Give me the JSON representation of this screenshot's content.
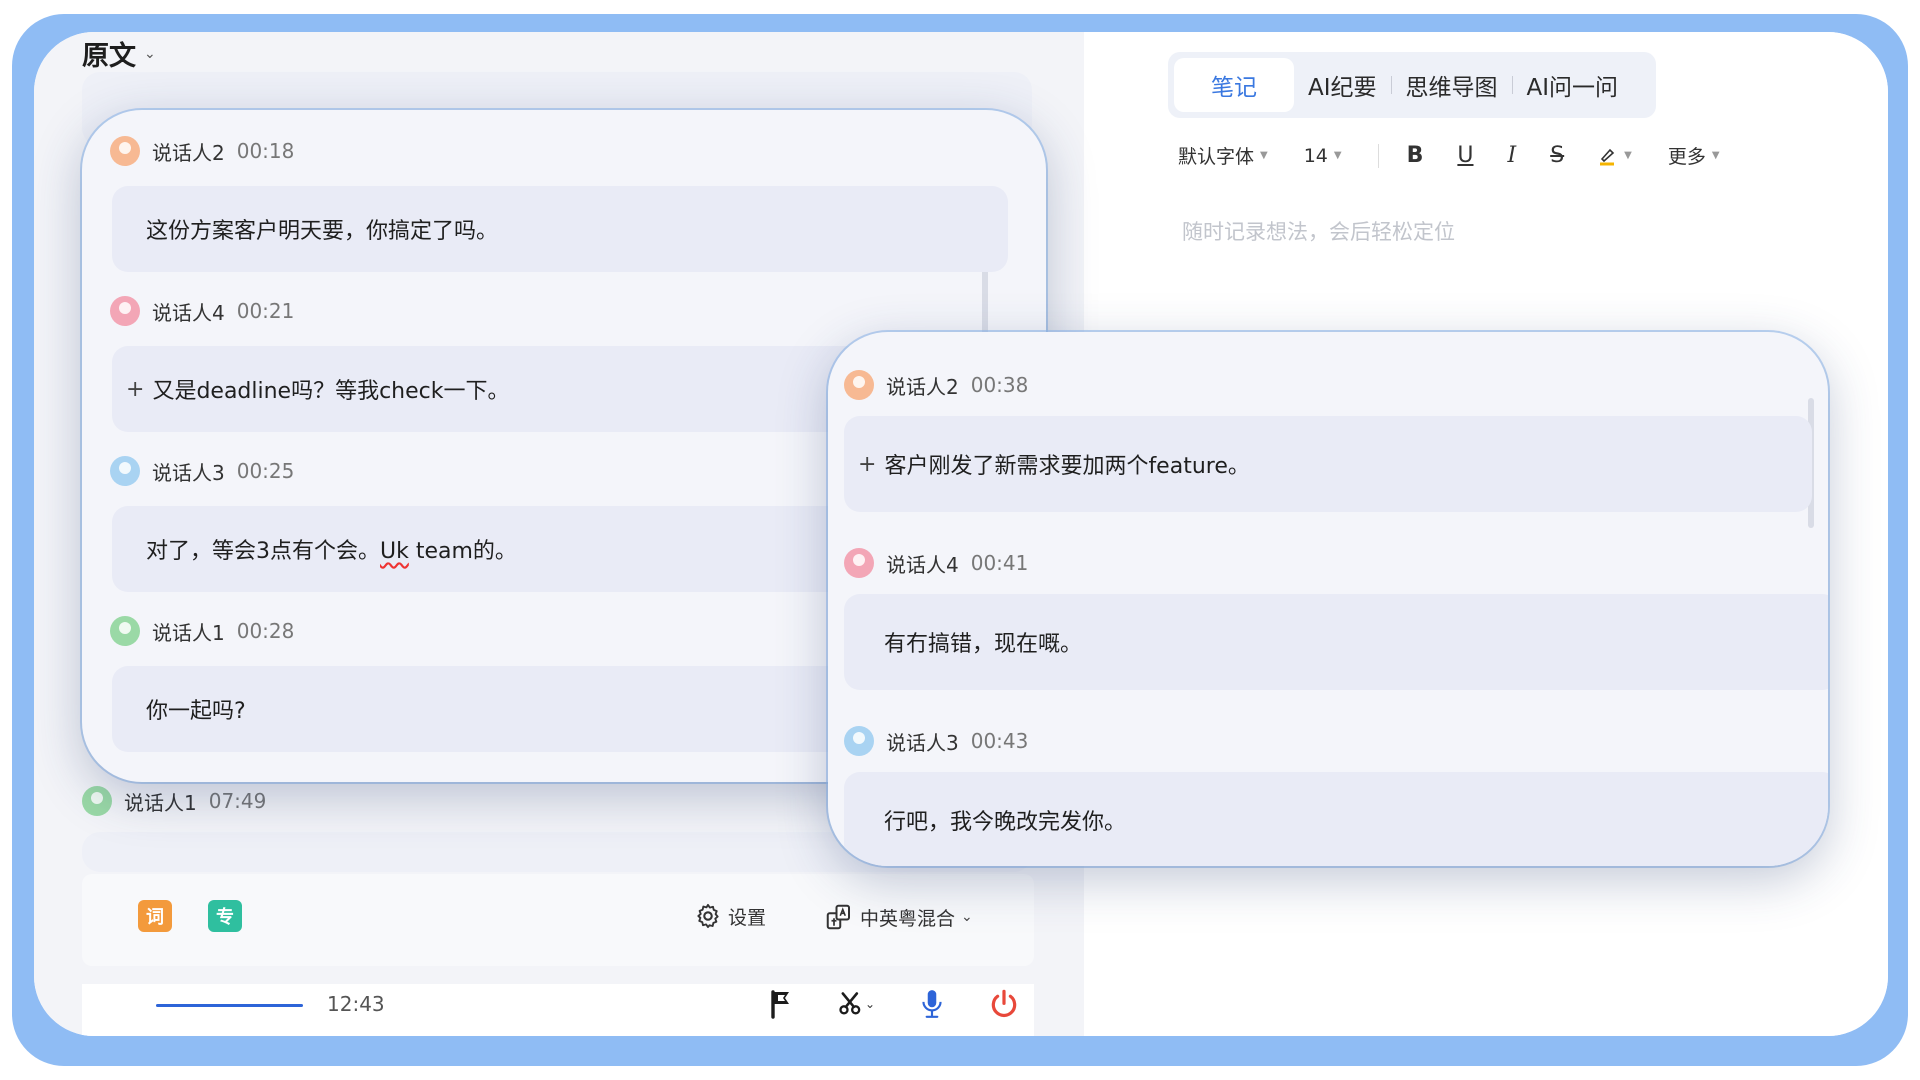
{
  "left": {
    "header_title": "原文",
    "tail_speaker": "说话人1",
    "tail_time": "07:49",
    "controls": {
      "badge_ci": "词",
      "badge_zhuan": "专",
      "settings_label": "设置",
      "language_label": "中英粤混合"
    },
    "player": {
      "progress": 0.15,
      "total_time": "12:43"
    }
  },
  "right": {
    "tabs": [
      "笔记",
      "AI纪要",
      "思维导图",
      "AI问一问"
    ],
    "toolbar": {
      "font": "默认字体",
      "size": "14",
      "more": "更多"
    },
    "note_placeholder": "随时记录想法，会后轻松定位"
  },
  "bubble_a": [
    {
      "speaker": "说话人2",
      "time": "00:18",
      "text": "这份方案客户明天要，你搞定了吗。",
      "color": "#f7b993"
    },
    {
      "speaker": "说话人4",
      "time": "00:21",
      "text": "又是deadline吗？等我check一下。",
      "color": "#f3a6b6",
      "plus": "+"
    },
    {
      "speaker": "说话人3",
      "time": "00:25",
      "text_pre": "对了，等会3点有个会。",
      "text_wavy": "Uk",
      "text_post": " team的。",
      "color": "#a9d3f2"
    },
    {
      "speaker": "说话人1",
      "time": "00:28",
      "text": "你一起吗?",
      "color": "#9ad9a6"
    }
  ],
  "bubble_b": [
    {
      "speaker": "说话人2",
      "time": "00:38",
      "text": "客户刚发了新需求要加两个feature。",
      "color": "#f7b993",
      "plus": "+"
    },
    {
      "speaker": "说话人4",
      "time": "00:41",
      "text": "有冇搞错，现在嘅。",
      "color": "#f3a6b6"
    },
    {
      "speaker": "说话人3",
      "time": "00:43",
      "text": "行吧，我今晚改完发你。",
      "color": "#a9d3f2"
    }
  ],
  "colors": {
    "frame": "#8fbcf4",
    "accent": "#3a78e0",
    "record_red": "#e8483a",
    "mic_blue": "#2d64d8"
  }
}
